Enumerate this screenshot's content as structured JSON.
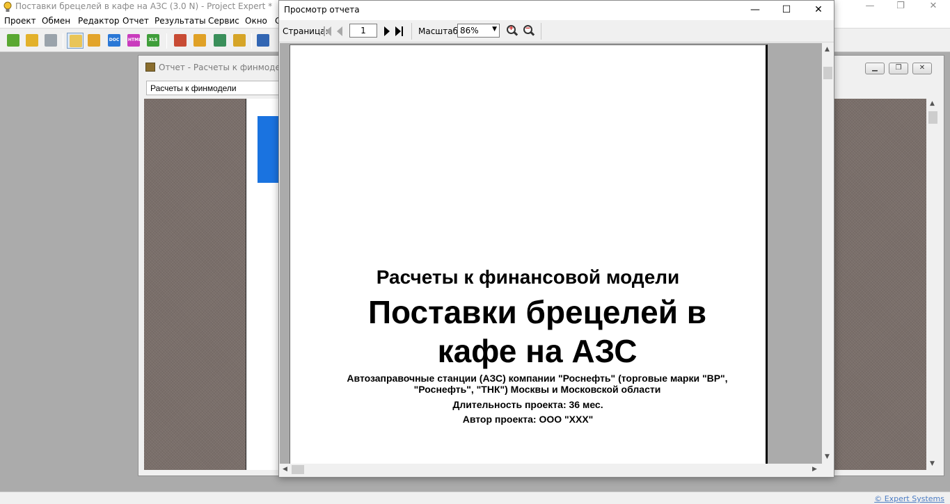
{
  "app": {
    "title": "Поставки брецелей в кафе на АЗС (3.0 N) - Project Expert *",
    "window_controls": {
      "minimize": "—",
      "maximize": "❐",
      "close": "✕"
    }
  },
  "menu": [
    "Проект",
    "Обмен",
    "Редактор",
    "Отчет",
    "Результаты",
    "Сервис",
    "Окно",
    "С"
  ],
  "toolbar": {
    "icons": [
      {
        "name": "new-project-icon",
        "color": "#5aa832"
      },
      {
        "name": "open-project-icon",
        "color": "#e3b12a"
      },
      {
        "name": "save-project-icon",
        "color": "#9aa3ab"
      },
      {
        "name": "preview-report-icon",
        "color": "#e9c558"
      },
      {
        "name": "print-icon",
        "color": "#e3a42a"
      },
      {
        "name": "export-doc-icon",
        "color": "#2a78d6",
        "label": "DOC"
      },
      {
        "name": "export-html-icon",
        "color": "#c93bbd",
        "label": "HTML"
      },
      {
        "name": "export-xls-icon",
        "color": "#3f9e3a",
        "label": "XLS"
      },
      {
        "name": "analysis-icon",
        "color": "#c84b34"
      },
      {
        "name": "edit-pencil-icon",
        "color": "#e0a126"
      },
      {
        "name": "money-icon",
        "color": "#3a8f5a"
      },
      {
        "name": "chart-table-icon",
        "color": "#d6a528"
      },
      {
        "name": "report-print-icon",
        "color": "#3266b3"
      }
    ]
  },
  "report_window": {
    "title": "Отчет - Расчеты к финмодели",
    "combo_value": "Расчеты к финмодели",
    "controls": {
      "minimize": "▁",
      "restore": "❐",
      "close": "✕"
    }
  },
  "preview_window": {
    "title": "Просмотр отчета",
    "controls": {
      "minimize": "—",
      "maximize": "☐",
      "close": "✕"
    },
    "page_label": "Страница:",
    "page_value": "1",
    "zoom_label": "Масштаб:",
    "zoom_value": "86%"
  },
  "document": {
    "heading": "Расчеты к финансовой модели",
    "title_line1": "Поставки брецелей в",
    "title_line2": "кафе на АЗС",
    "description_line1": "Автозаправочные станции (АЗС) компании \"Роснефть\" (торговые марки \"ВР\",",
    "description_line2": "\"Роснефть\", \"ТНК\") Москвы и Московской области",
    "duration": "Длительность проекта: 36 мес.",
    "author": "Автор проекта: ООО \"ХХХ\""
  },
  "statusbar": {
    "copyright": "© Expert Systems"
  },
  "colors": {
    "accent_bar": "#1a73e0",
    "canvas_texture": "#7a6f6a",
    "link": "#4b7cc3"
  }
}
